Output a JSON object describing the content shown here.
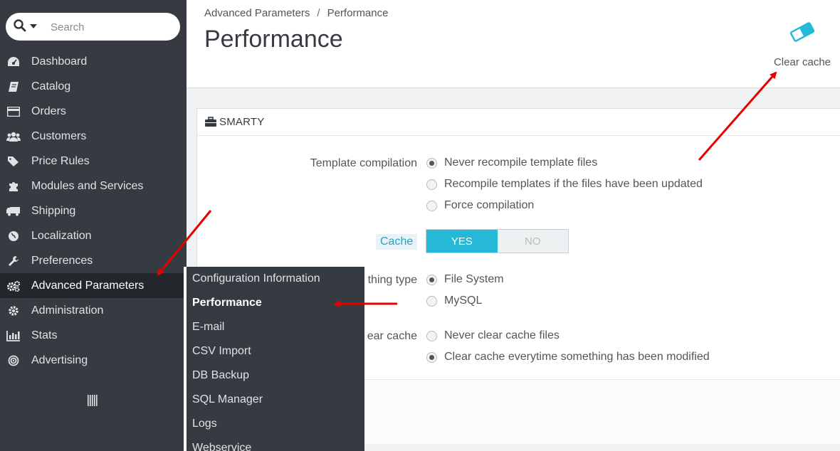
{
  "search": {
    "placeholder": "Search"
  },
  "sidebar": {
    "items": [
      {
        "label": "Dashboard",
        "icon": "dashboard-icon"
      },
      {
        "label": "Catalog",
        "icon": "book-icon"
      },
      {
        "label": "Orders",
        "icon": "credit-card-icon"
      },
      {
        "label": "Customers",
        "icon": "users-icon"
      },
      {
        "label": "Price Rules",
        "icon": "tags-icon"
      },
      {
        "label": "Modules and Services",
        "icon": "puzzle-icon"
      },
      {
        "label": "Shipping",
        "icon": "truck-icon"
      },
      {
        "label": "Localization",
        "icon": "globe-icon"
      },
      {
        "label": "Preferences",
        "icon": "wrench-icon"
      },
      {
        "label": "Advanced Parameters",
        "icon": "cogs-icon"
      },
      {
        "label": "Administration",
        "icon": "gear-icon"
      },
      {
        "label": "Stats",
        "icon": "bar-chart-icon"
      },
      {
        "label": "Advertising",
        "icon": "bullseye-icon"
      }
    ],
    "active_index": 9
  },
  "submenu": {
    "items": [
      "Configuration Information",
      "Performance",
      "E-mail",
      "CSV Import",
      "DB Backup",
      "SQL Manager",
      "Logs",
      "Webservice"
    ],
    "current_index": 1
  },
  "header": {
    "breadcrumb": {
      "parent": "Advanced Parameters",
      "separator": "/",
      "current": "Performance"
    },
    "title": "Performance",
    "clear_cache_label": "Clear cache"
  },
  "panel": {
    "title": "SMARTY",
    "template_compilation": {
      "label": "Template compilation",
      "options": [
        {
          "label": "Never recompile template files",
          "checked": true
        },
        {
          "label": "Recompile templates if the files have been updated",
          "checked": false
        },
        {
          "label": "Force compilation",
          "checked": false
        }
      ]
    },
    "cache": {
      "label": "Cache",
      "yes": "YES",
      "no": "NO",
      "value": "YES"
    },
    "caching_type": {
      "label": "thing type",
      "options": [
        {
          "label": "File System",
          "checked": true
        },
        {
          "label": "MySQL",
          "checked": false
        }
      ]
    },
    "clear_cache": {
      "label": "ear cache",
      "options": [
        {
          "label": "Never clear cache files",
          "checked": false
        },
        {
          "label": "Clear cache everytime something has been modified",
          "checked": true
        }
      ]
    }
  },
  "colors": {
    "sidebar_bg": "#363a41",
    "accent": "#25b9d7",
    "arrow": "#e60000"
  }
}
